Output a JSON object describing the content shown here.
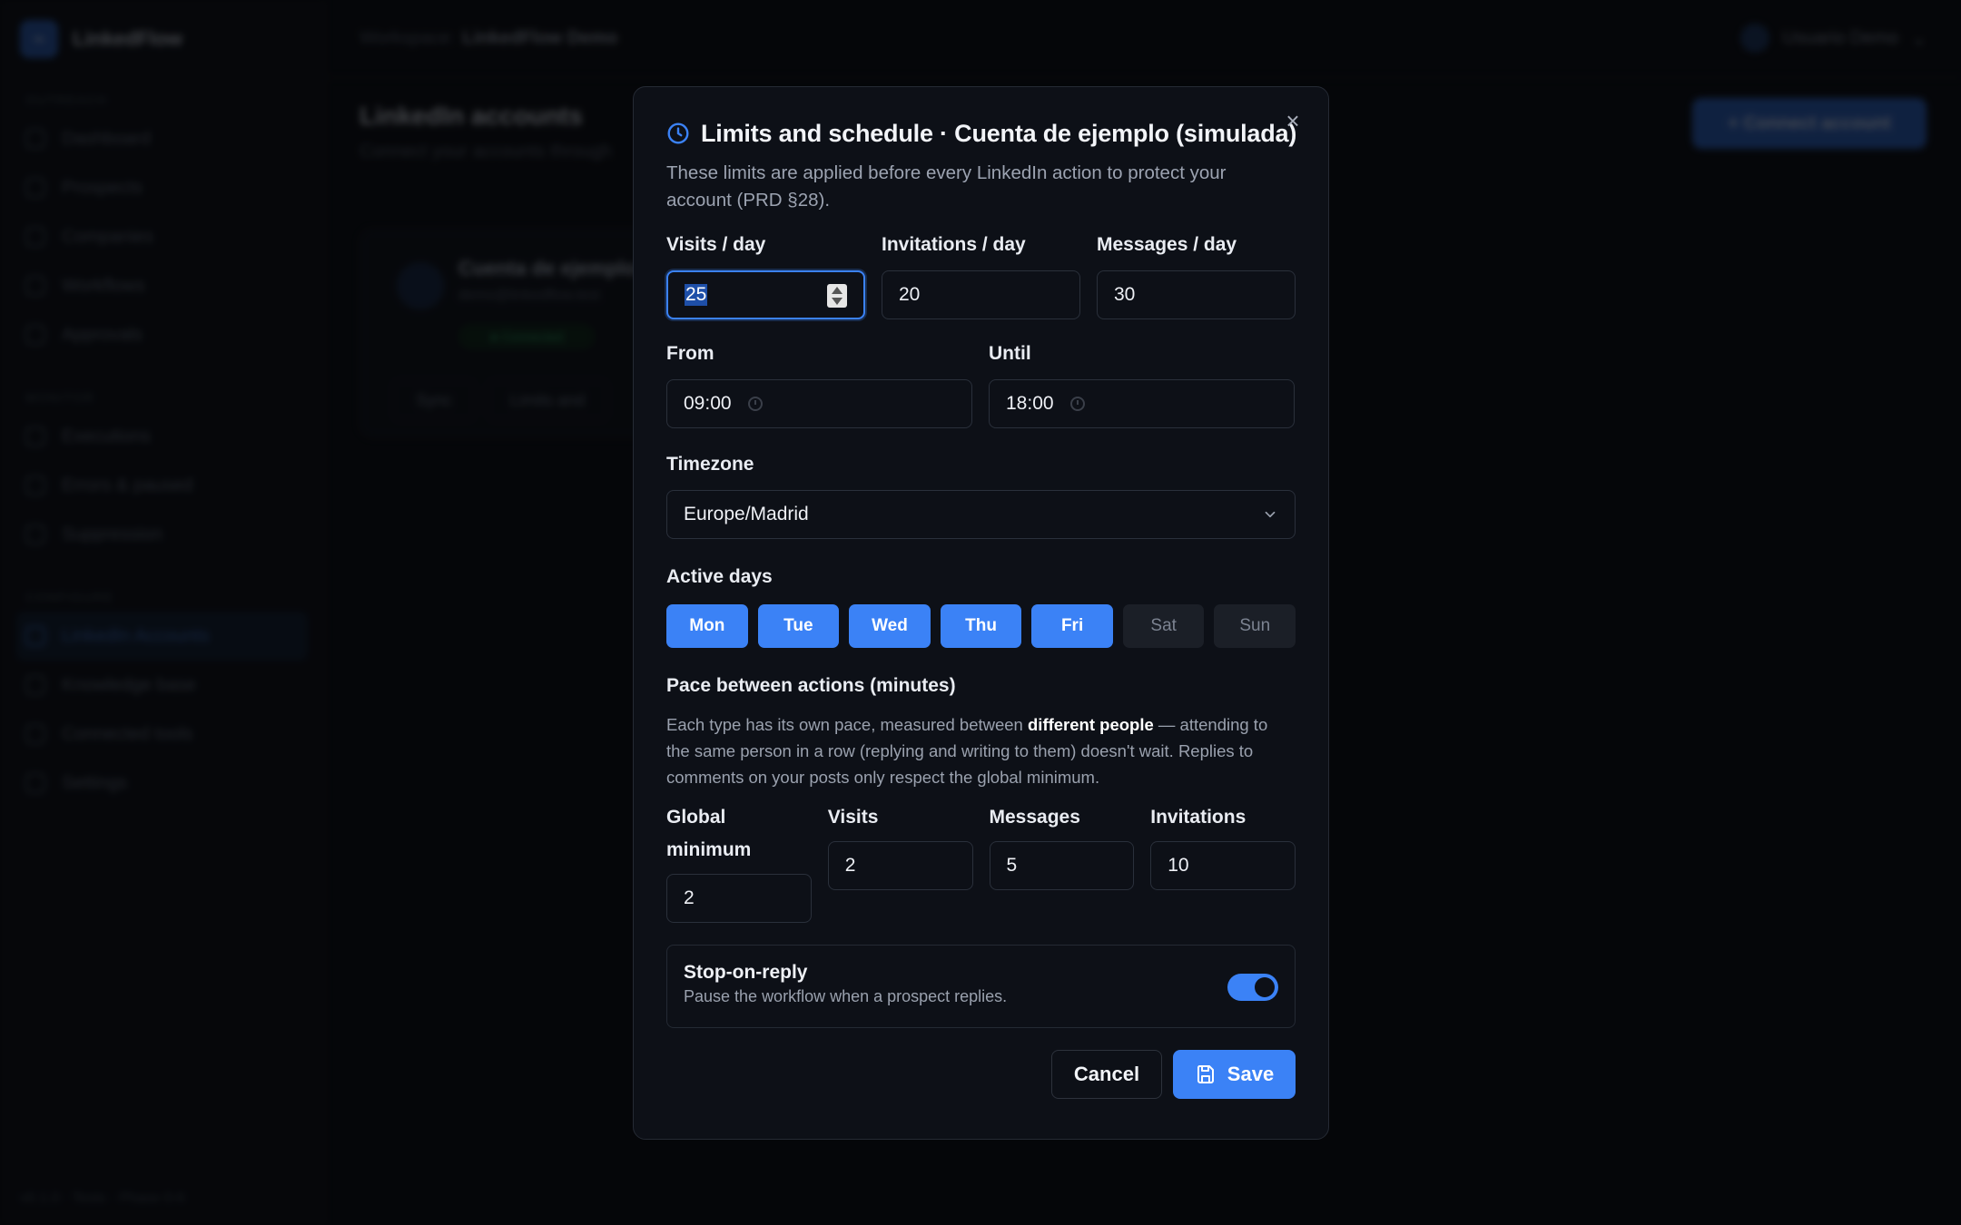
{
  "app": {
    "brand": "LinkedFlow",
    "workspace_label": "Workspace:",
    "workspace_name": "LinkedFlow Demo",
    "user_name": "Usuario Demo",
    "footer": "v0.1.0 · Tests · Phase 0-6",
    "nav_sections": [
      "Outreach",
      "Monitor",
      "Configure"
    ],
    "nav_outreach": [
      "Dashboard",
      "Prospects",
      "Companies",
      "Workflows",
      "Approvals"
    ],
    "nav_monitor": [
      "Executions",
      "Errors & paused",
      "Suppression"
    ],
    "nav_configure": [
      "LinkedIn Accounts",
      "Knowledge base",
      "Connected tools",
      "Settings"
    ],
    "page_title": "LinkedIn accounts",
    "page_subtitle": "Connect your accounts through",
    "connect_button": "+ Connect account",
    "account_card": {
      "name": "Cuenta de ejemplo",
      "email": "demo@linkedflow.test",
      "status": "● Connected",
      "btn_sync": "Sync",
      "btn_limits": "Limits and"
    }
  },
  "modal": {
    "title": "Limits and schedule · Cuenta de ejemplo (simulada)",
    "description": "These limits are applied before every LinkedIn action to protect your account (PRD §28).",
    "close_label": "×",
    "limits": {
      "visits_label": "Visits / day",
      "visits_value": "25",
      "invitations_label": "Invitations / day",
      "invitations_value": "20",
      "messages_label": "Messages / day",
      "messages_value": "30"
    },
    "schedule": {
      "from_label": "From",
      "from_value": "09:00",
      "until_label": "Until",
      "until_value": "18:00"
    },
    "timezone": {
      "label": "Timezone",
      "value": "Europe/Madrid"
    },
    "active_days": {
      "label": "Active days",
      "days": [
        {
          "label": "Mon",
          "active": true
        },
        {
          "label": "Tue",
          "active": true
        },
        {
          "label": "Wed",
          "active": true
        },
        {
          "label": "Thu",
          "active": true
        },
        {
          "label": "Fri",
          "active": true
        },
        {
          "label": "Sat",
          "active": false
        },
        {
          "label": "Sun",
          "active": false
        }
      ]
    },
    "pace": {
      "title": "Pace between actions (minutes)",
      "desc_before": "Each type has its own pace, measured between ",
      "desc_bold": "different people",
      "desc_after": " — attending to the same person in a row (replying and writing to them) doesn't wait. Replies to comments on your posts only respect the global minimum.",
      "global_label": "Global minimum",
      "global_value": "2",
      "visits_label": "Visits",
      "visits_value": "2",
      "messages_label": "Messages",
      "messages_value": "5",
      "invitations_label": "Invitations",
      "invitations_value": "10"
    },
    "stop_on_reply": {
      "title": "Stop-on-reply",
      "description": "Pause the workflow when a prospect replies.",
      "enabled": true
    },
    "cancel_label": "Cancel",
    "save_label": "Save",
    "colors": {
      "accent": "#3b82f6",
      "modal_bg": "#0d1017",
      "day_off_bg": "#1b1f27"
    }
  }
}
